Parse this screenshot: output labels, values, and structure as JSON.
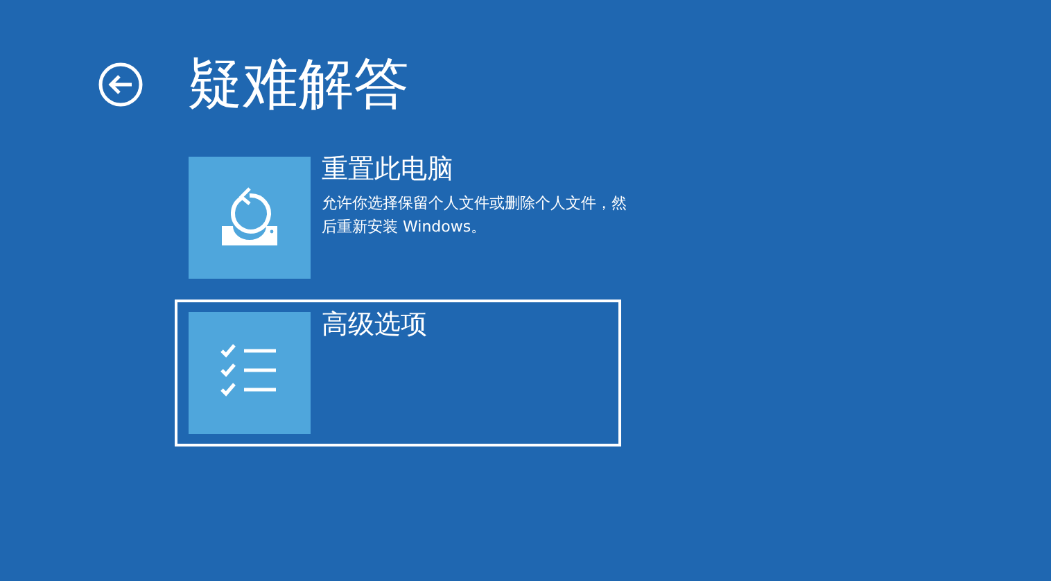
{
  "title": "疑难解答",
  "options": [
    {
      "kind": "reset",
      "title": "重置此电脑",
      "description": "允许你选择保留个人文件或删除个人文件，然后重新安装 Windows。",
      "selected": false
    },
    {
      "kind": "checklist",
      "title": "高级选项",
      "selected": true
    }
  ]
}
